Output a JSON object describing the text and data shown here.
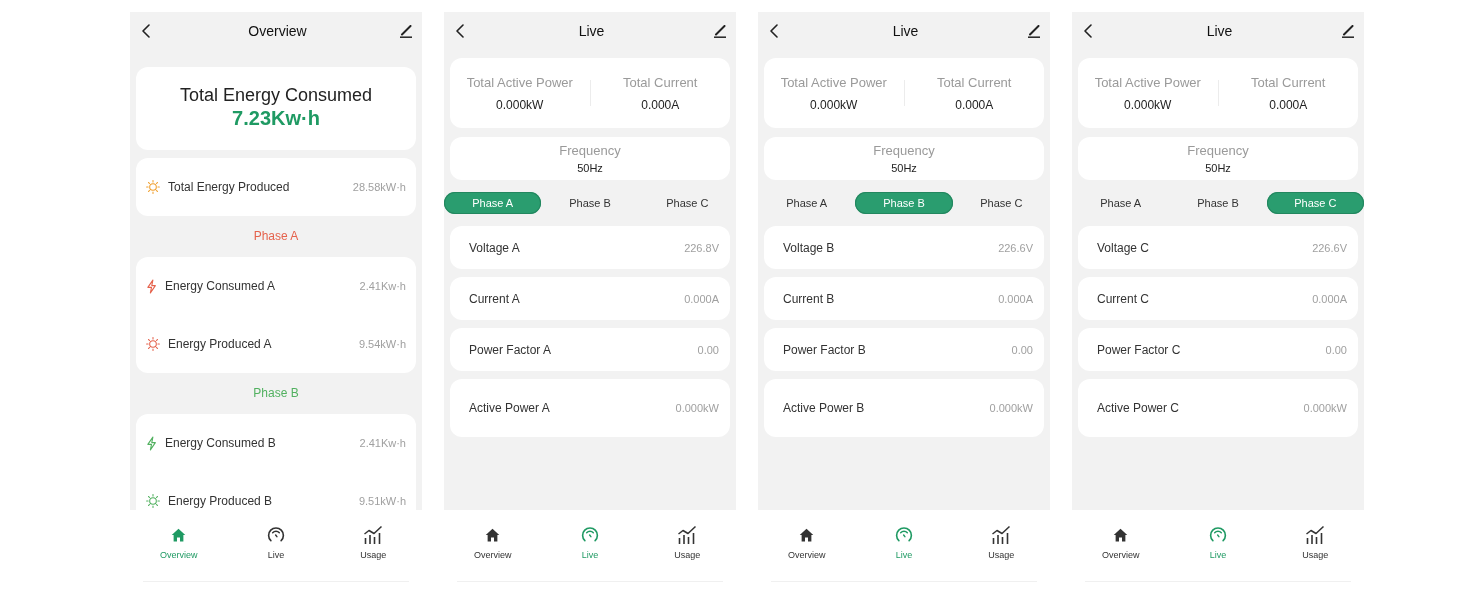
{
  "screens": [
    {
      "kind": "overview",
      "title": "Overview",
      "total": {
        "label": "Total Energy Consumed",
        "value": "7.23Kw·h"
      },
      "total_produced": {
        "label": "Total Energy Produced",
        "value": "28.58kW·h"
      },
      "phases": [
        {
          "title": "Phase A",
          "color": "#e5624c",
          "rows": [
            {
              "kind": "consumed",
              "label": "Energy Consumed A",
              "value": "2.41Kw·h"
            },
            {
              "kind": "produced",
              "label": "Energy Produced A",
              "value": "9.54kW·h"
            }
          ]
        },
        {
          "title": "Phase B",
          "color": "#52b160",
          "rows": [
            {
              "kind": "consumed",
              "label": "Energy Consumed B",
              "value": "2.41Kw·h"
            },
            {
              "kind": "produced",
              "label": "Energy Produced B",
              "value": "9.51kW·h"
            }
          ]
        }
      ],
      "tab_bar": [
        {
          "label": "Overview",
          "selected": true
        },
        {
          "label": "Live",
          "selected": false
        },
        {
          "label": "Usage",
          "selected": false
        }
      ]
    },
    {
      "kind": "live",
      "title": "Live",
      "totals": [
        {
          "label": "Total Active Power",
          "value": "0.000kW"
        },
        {
          "label": "Total Current",
          "value": "0.000A"
        }
      ],
      "frequency": {
        "label": "Frequency",
        "value": "50Hz"
      },
      "phase_tabs": [
        {
          "label": "Phase A",
          "selected": true
        },
        {
          "label": "Phase B",
          "selected": false
        },
        {
          "label": "Phase C",
          "selected": false
        }
      ],
      "readings": [
        {
          "label": "Voltage A",
          "value": "226.8V"
        },
        {
          "label": "Current A",
          "value": "0.000A"
        },
        {
          "label": "Power Factor A",
          "value": "0.00"
        },
        {
          "label": "Active Power A",
          "value": "0.000kW"
        }
      ],
      "tab_bar": [
        {
          "label": "Overview",
          "selected": false
        },
        {
          "label": "Live",
          "selected": true
        },
        {
          "label": "Usage",
          "selected": false
        }
      ]
    },
    {
      "kind": "live",
      "title": "Live",
      "totals": [
        {
          "label": "Total Active Power",
          "value": "0.000kW"
        },
        {
          "label": "Total Current",
          "value": "0.000A"
        }
      ],
      "frequency": {
        "label": "Frequency",
        "value": "50Hz"
      },
      "phase_tabs": [
        {
          "label": "Phase A",
          "selected": false
        },
        {
          "label": "Phase B",
          "selected": true
        },
        {
          "label": "Phase C",
          "selected": false
        }
      ],
      "readings": [
        {
          "label": "Voltage B",
          "value": "226.6V"
        },
        {
          "label": "Current B",
          "value": "0.000A"
        },
        {
          "label": "Power Factor B",
          "value": "0.00"
        },
        {
          "label": "Active Power B",
          "value": "0.000kW"
        }
      ],
      "tab_bar": [
        {
          "label": "Overview",
          "selected": false
        },
        {
          "label": "Live",
          "selected": true
        },
        {
          "label": "Usage",
          "selected": false
        }
      ]
    },
    {
      "kind": "live",
      "title": "Live",
      "totals": [
        {
          "label": "Total Active Power",
          "value": "0.000kW"
        },
        {
          "label": "Total Current",
          "value": "0.000A"
        }
      ],
      "frequency": {
        "label": "Frequency",
        "value": "50Hz"
      },
      "phase_tabs": [
        {
          "label": "Phase A",
          "selected": false
        },
        {
          "label": "Phase B",
          "selected": false
        },
        {
          "label": "Phase C",
          "selected": true
        }
      ],
      "readings": [
        {
          "label": "Voltage C",
          "value": "226.6V"
        },
        {
          "label": "Current C",
          "value": "0.000A"
        },
        {
          "label": "Power Factor C",
          "value": "0.00"
        },
        {
          "label": "Active Power C",
          "value": "0.000kW"
        }
      ],
      "tab_bar": [
        {
          "label": "Overview",
          "selected": false
        },
        {
          "label": "Live",
          "selected": true
        },
        {
          "label": "Usage",
          "selected": false
        }
      ]
    }
  ]
}
